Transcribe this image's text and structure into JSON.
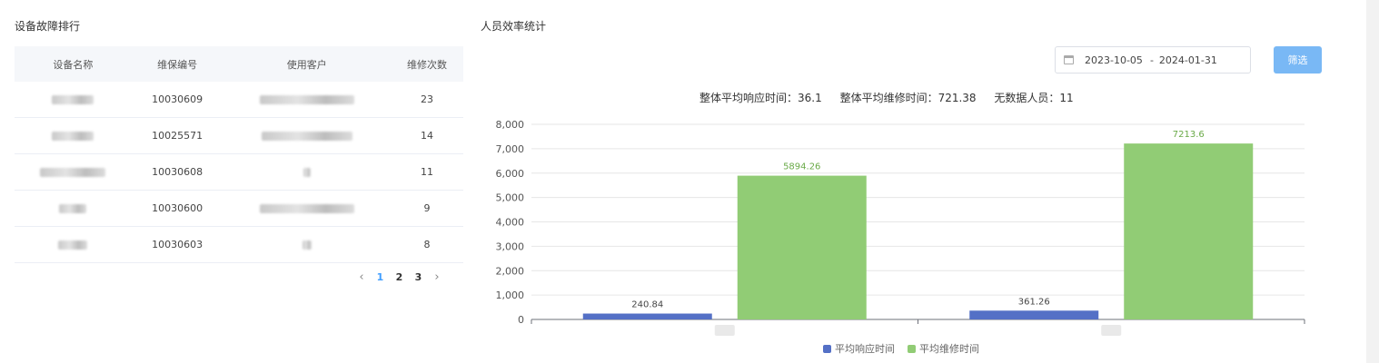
{
  "left": {
    "title": "设备故障排行",
    "columns": [
      "设备名称",
      "维保编号",
      "使用客户",
      "维修次数"
    ],
    "rows": [
      {
        "code": "10030609",
        "count": "23"
      },
      {
        "code": "10025571",
        "count": "14"
      },
      {
        "code": "10030608",
        "count": "11"
      },
      {
        "code": "10030600",
        "count": "9"
      },
      {
        "code": "10030603",
        "count": "8"
      }
    ],
    "pager": {
      "prev": "‹",
      "pages": [
        "1",
        "2",
        "3"
      ],
      "next": "›",
      "current": "1"
    }
  },
  "right": {
    "title": "人员效率统计",
    "date_start": "2023-10-05",
    "date_sep": "-",
    "date_end": "2024-01-31",
    "filter_label": "筛选",
    "summary": {
      "response": "整体平均响应时间：36.1",
      "repair": "整体平均维修时间：721.38",
      "no_data": "无数据人员：11"
    }
  },
  "chart_data": {
    "type": "bar",
    "categories": [
      "",
      ""
    ],
    "series": [
      {
        "name": "平均响应时间",
        "values": [
          240.84,
          361.26
        ],
        "color": "#5470c6"
      },
      {
        "name": "平均维修时间",
        "values": [
          5894.26,
          7213.6
        ],
        "color": "#91cc75"
      }
    ],
    "ylim": [
      0,
      8000
    ],
    "yticks": [
      "0",
      "1,000",
      "2,000",
      "3,000",
      "4,000",
      "5,000",
      "6,000",
      "7,000",
      "8,000"
    ],
    "grid": true,
    "legend": "bottom"
  }
}
